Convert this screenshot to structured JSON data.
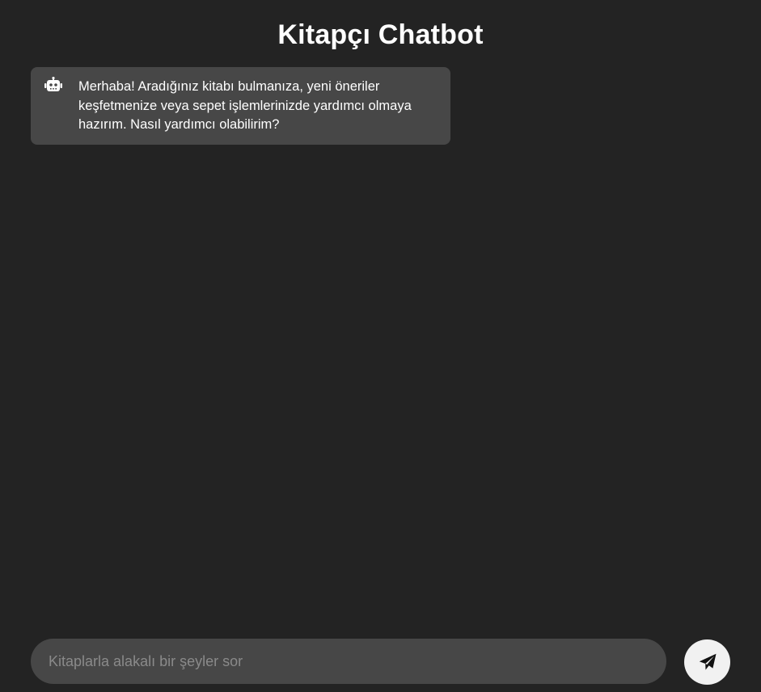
{
  "header": {
    "title": "Kitapçı Chatbot"
  },
  "messages": [
    {
      "sender": "bot",
      "icon": "robot-icon",
      "text": "Merhaba! Aradığınız kitabı bulmanıza, yeni öneriler keşfetmenize veya sepet işlemlerinizde yardımcı olmaya hazırım. Nasıl yardımcı olabilirim?"
    }
  ],
  "composer": {
    "placeholder": "Kitaplarla alakalı bir şeyler sor",
    "value": "",
    "send_icon": "send-icon"
  },
  "colors": {
    "background": "#232323",
    "bubble": "#474747",
    "input": "#474747",
    "send_button": "#f1f1f1",
    "text": "#ffffff",
    "placeholder": "#8a8a8a"
  }
}
